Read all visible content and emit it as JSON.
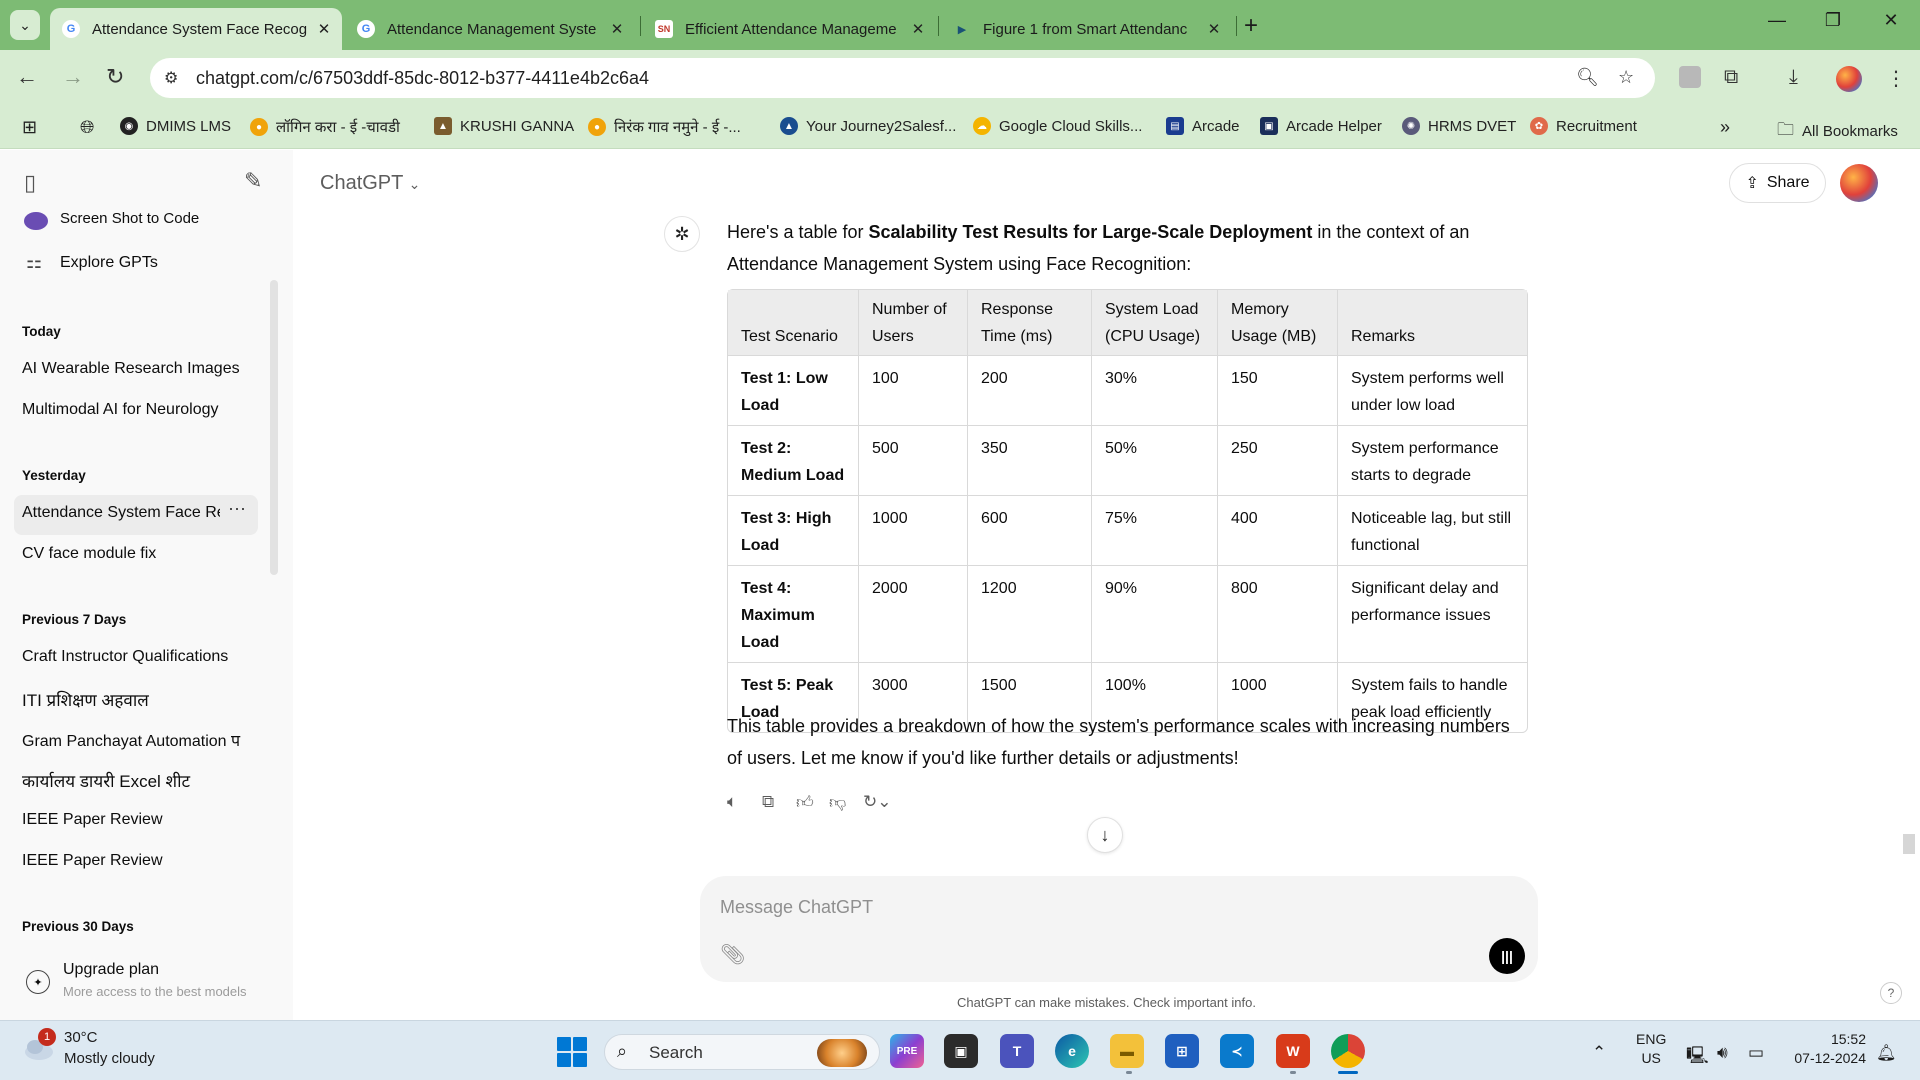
{
  "browser": {
    "tabs": [
      {
        "title": "Attendance System Face Recog",
        "active": true
      },
      {
        "title": "Attendance Management Syste",
        "active": false
      },
      {
        "title": "Efficient Attendance Manageme",
        "active": false
      },
      {
        "title": "Figure 1 from Smart Attendanc",
        "active": false
      }
    ],
    "url": "chatgpt.com/c/67503ddf-85dc-8012-b377-4411e4b2c6a4",
    "bookmarks": [
      "DMIMS LMS",
      "लॉगिन करा - ई -चावडी",
      "KRUSHI GANNA",
      "निरंक गाव नमुने - ई -...",
      "Your Journey2Salesf...",
      "Google Cloud Skills...",
      "Arcade",
      "Arcade Helper",
      "HRMS DVET",
      "Recruitment"
    ],
    "all_bookmarks": "All Bookmarks"
  },
  "sidebar": {
    "top_items": [
      "Screen Shot to Code",
      "Explore GPTs"
    ],
    "groups": [
      {
        "heading": "Today",
        "items": [
          "AI Wearable Research Images",
          "Multimodal AI for Neurology"
        ]
      },
      {
        "heading": "Yesterday",
        "items": [
          "Attendance System Face Rec",
          "CV face module fix"
        ]
      },
      {
        "heading": "Previous 7 Days",
        "items": [
          "Craft Instructor Qualifications",
          "ITI प्रशिक्षण अहवाल",
          "Gram Panchayat Automation प",
          "कार्यालय डायरी Excel शीट",
          "IEEE Paper Review",
          "IEEE Paper Review"
        ]
      },
      {
        "heading": "Previous 30 Days",
        "items": []
      }
    ],
    "upgrade": {
      "title": "Upgrade plan",
      "subtitle": "More access to the best models"
    }
  },
  "header": {
    "model": "ChatGPT",
    "share_label": "Share"
  },
  "message": {
    "intro_pre": "Here's a table for ",
    "intro_bold": "Scalability Test Results for Large-Scale Deployment",
    "intro_post": " in the context of an Attendance Management System using Face Recognition:",
    "table": {
      "headers": [
        "Test Scenario",
        "Number of Users",
        "Response Time (ms)",
        "System Load (CPU Usage)",
        "Memory Usage (MB)",
        "Remarks"
      ],
      "rows": [
        [
          "Test 1: Low Load",
          "100",
          "200",
          "30%",
          "150",
          "System performs well under low load"
        ],
        [
          "Test 2: Medium Load",
          "500",
          "350",
          "50%",
          "250",
          "System performance starts to degrade"
        ],
        [
          "Test 3: High Load",
          "1000",
          "600",
          "75%",
          "400",
          "Noticeable lag, but still functional"
        ],
        [
          "Test 4: Maximum Load",
          "2000",
          "1200",
          "90%",
          "800",
          "Significant delay and performance issues"
        ],
        [
          "Test 5: Peak Load",
          "3000",
          "1500",
          "100%",
          "1000",
          "System fails to handle peak load efficiently"
        ]
      ]
    },
    "outro": "This table provides a breakdown of how the system's performance scales with increasing numbers of users. Let me know if you'd like further details or adjustments!"
  },
  "composer": {
    "placeholder": "Message ChatGPT",
    "disclaimer": "ChatGPT can make mistakes. Check important info.",
    "help": "?"
  },
  "taskbar": {
    "weather_temp": "30°C",
    "weather_desc": "Mostly cloudy",
    "weather_badge": "1",
    "search_label": "Search",
    "lang_1": "ENG",
    "lang_2": "US",
    "time": "15:52",
    "date": "07-12-2024"
  }
}
